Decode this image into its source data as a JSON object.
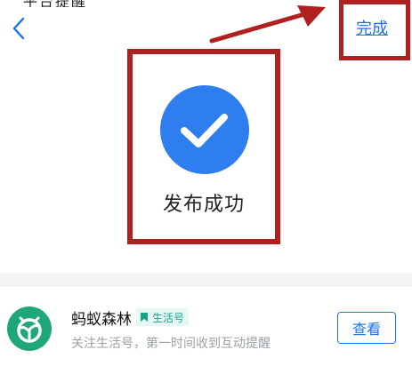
{
  "header": {
    "done_label": "完成",
    "back_icon": "chevron-left-icon"
  },
  "status_strip": {
    "clipped_text": "平台提醒"
  },
  "success": {
    "icon": "check-circle-icon",
    "message": "发布成功"
  },
  "promo": {
    "avatar_icon": "ant-forest-sprout-icon",
    "account_name": "蚂蚁森林",
    "badge_label": "生活号",
    "description": "关注生活号，第一时间收到互动提醒",
    "view_button": "查看"
  },
  "colors": {
    "accent_blue": "#1a73e8",
    "check_blue": "#2e7ef0",
    "highlight_red": "#b0201e",
    "forest_green": "#1fa77a"
  }
}
